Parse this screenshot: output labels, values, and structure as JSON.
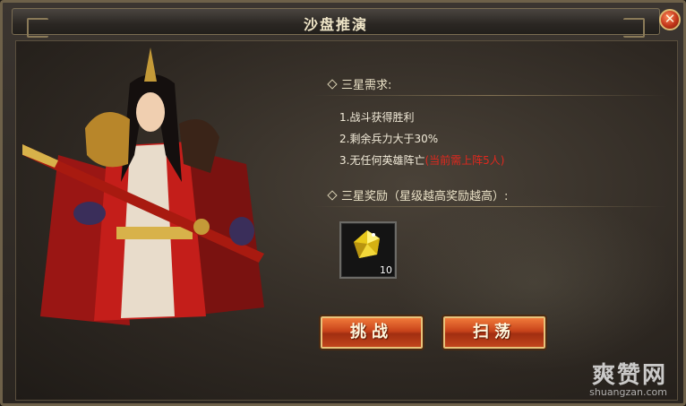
{
  "window": {
    "title": "沙盘推演",
    "close_label": "✕"
  },
  "requirements": {
    "heading": "三星需求:",
    "items": [
      {
        "text": "1.战斗获得胜利",
        "note": ""
      },
      {
        "text": "2.剩余兵力大于30%",
        "note": ""
      },
      {
        "text": "3.无任何英雄阵亡",
        "note": "(当前需上阵5人)"
      }
    ]
  },
  "rewards": {
    "heading": "三星奖励（星级越高奖励越高）:",
    "items": [
      {
        "icon": "yellow-gem-icon",
        "count": "10"
      }
    ]
  },
  "buttons": {
    "challenge": "挑战",
    "sweep": "扫荡"
  },
  "watermark": {
    "cn": "爽赞网",
    "en": "shuangzan.com"
  },
  "colors": {
    "accent": "#c8431a",
    "note": "#e0281e",
    "text": "#f1ead8"
  }
}
